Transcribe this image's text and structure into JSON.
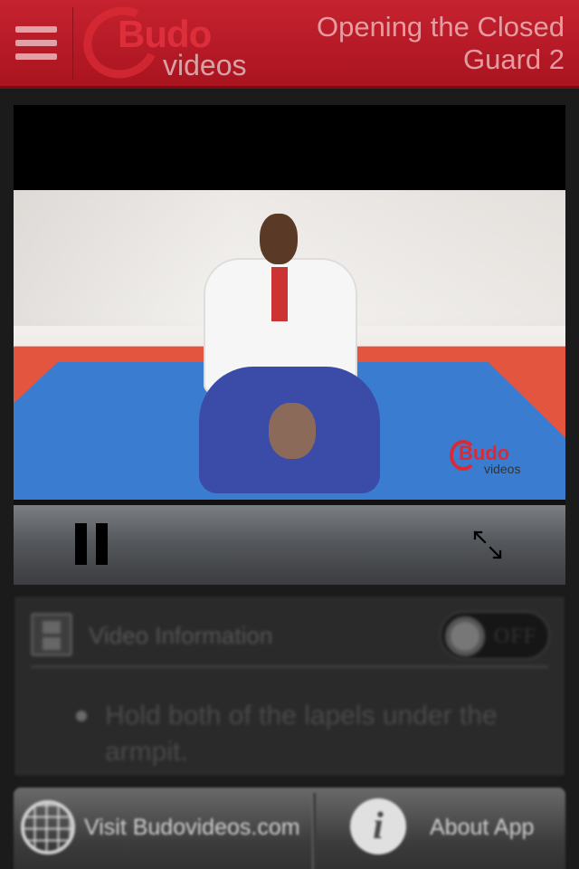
{
  "header": {
    "title": "Opening the Closed Guard 2",
    "logo_primary": "Budo",
    "logo_secondary": "videos",
    "menu_icon": "hamburger-icon"
  },
  "video": {
    "watermark_primary": "Budo",
    "watermark_secondary": "videos",
    "state": "playing",
    "controls": {
      "pause_icon": "pause-icon",
      "fullscreen_icon": "fullscreen-icon"
    }
  },
  "info": {
    "icon": "film-icon",
    "title": "Video Information",
    "toggle_label": "OFF",
    "bullets": [
      "Hold both of the lapels under the armpit."
    ]
  },
  "bottom": {
    "visit_label": "Visit Budovideos.com",
    "visit_icon": "globe-icon",
    "about_label": "About App",
    "about_icon": "info-icon",
    "about_glyph": "i"
  }
}
